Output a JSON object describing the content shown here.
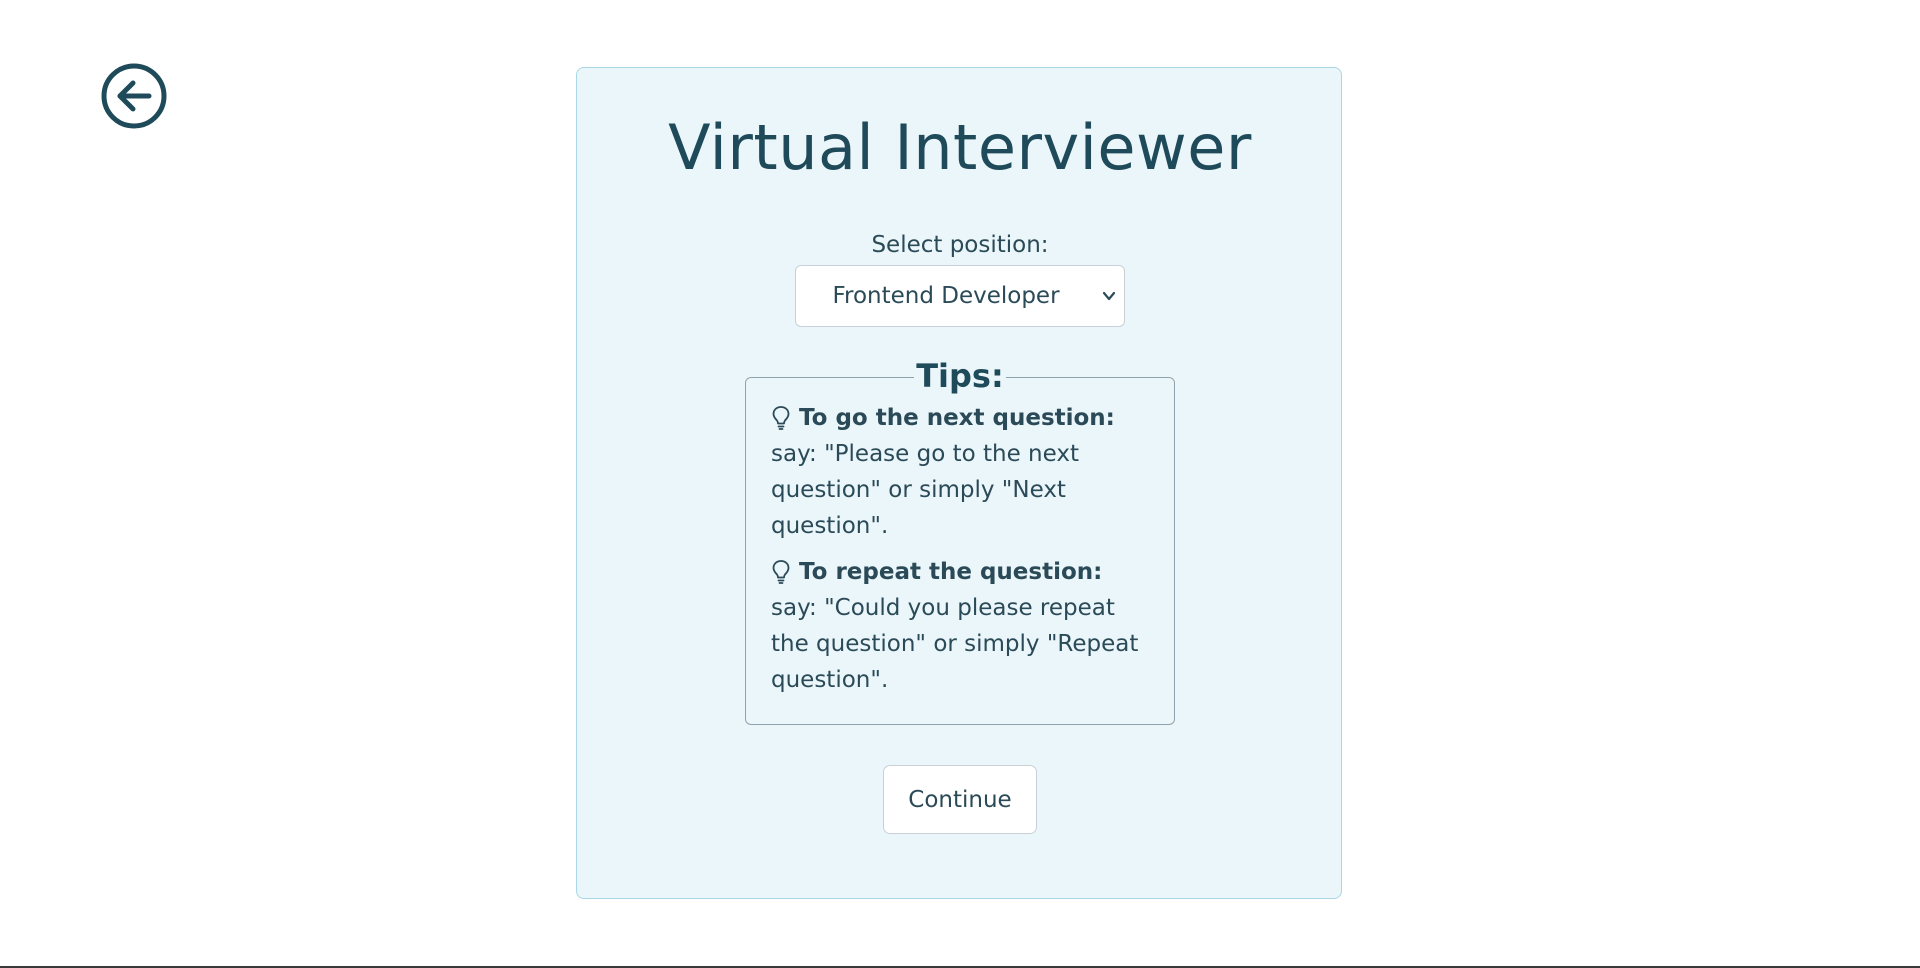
{
  "page": {
    "title": "Virtual Interviewer"
  },
  "back_button": {
    "icon": "arrow-left-circle-icon"
  },
  "position_select": {
    "label": "Select position:",
    "selected": "Frontend Developer"
  },
  "tips": {
    "heading": "Tips:",
    "items": [
      {
        "icon": "lightbulb-icon",
        "title": "To go the next question:",
        "text": "say: \"Please go to the next question\" or simply \"Next question\"."
      },
      {
        "icon": "lightbulb-icon",
        "title": "To repeat the question:",
        "text": "say: \"Could you please repeat the question\" or simply \"Repeat question\"."
      }
    ]
  },
  "continue_button": {
    "label": "Continue"
  },
  "colors": {
    "primary": "#1f4a5a",
    "card_background": "#ebf6fb",
    "card_border": "#a9d7e6"
  }
}
